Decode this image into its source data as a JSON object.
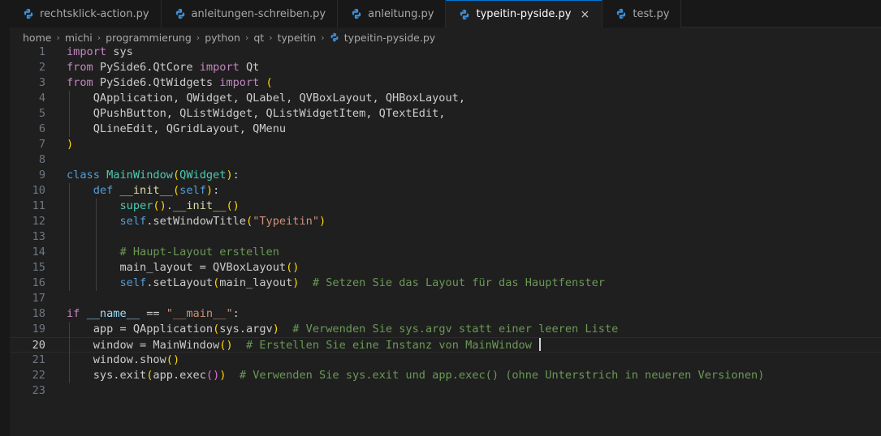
{
  "tabs": [
    {
      "label": "rechtsklick-action.py",
      "active": false
    },
    {
      "label": "anleitungen-schreiben.py",
      "active": false
    },
    {
      "label": "anleitung.py",
      "active": false
    },
    {
      "label": "typeitin-pyside.py",
      "active": true
    },
    {
      "label": "test.py",
      "active": false
    }
  ],
  "tab_close_glyph": "×",
  "breadcrumb": {
    "folders": [
      "home",
      "michi",
      "programmierung",
      "python",
      "qt",
      "typeitin"
    ],
    "file": "typeitin-pyside.py",
    "separator": "›"
  },
  "editor": {
    "current_line": 20,
    "lines": [
      {
        "n": "1",
        "tokens": [
          [
            "import",
            "kw2"
          ],
          [
            " sys",
            "tx"
          ]
        ]
      },
      {
        "n": "2",
        "tokens": [
          [
            "from",
            "kw2"
          ],
          [
            " PySide6.QtCore ",
            "tx"
          ],
          [
            "import",
            "kw2"
          ],
          [
            " Qt",
            "tx"
          ]
        ]
      },
      {
        "n": "3",
        "tokens": [
          [
            "from",
            "kw2"
          ],
          [
            " PySide6.QtWidgets ",
            "tx"
          ],
          [
            "import",
            "kw2"
          ],
          [
            " ",
            "tx"
          ],
          [
            "(",
            "br1"
          ]
        ]
      },
      {
        "n": "4",
        "tokens": [
          [
            "    QApplication, QWidget, QLabel, QVBoxLayout, QHBoxLayout,",
            "tx"
          ]
        ]
      },
      {
        "n": "5",
        "tokens": [
          [
            "    QPushButton, QListWidget, QListWidgetItem, QTextEdit,",
            "tx"
          ]
        ]
      },
      {
        "n": "6",
        "tokens": [
          [
            "    QLineEdit, QGridLayout, QMenu",
            "tx"
          ]
        ]
      },
      {
        "n": "7",
        "tokens": [
          [
            ")",
            "br1"
          ]
        ]
      },
      {
        "n": "8",
        "tokens": []
      },
      {
        "n": "9",
        "tokens": [
          [
            "class",
            "kw"
          ],
          [
            " ",
            "tx"
          ],
          [
            "MainWindow",
            "cls"
          ],
          [
            "(",
            "br1"
          ],
          [
            "QWidget",
            "cls"
          ],
          [
            ")",
            "br1"
          ],
          [
            ":",
            "tx"
          ]
        ]
      },
      {
        "n": "10",
        "tokens": [
          [
            "    ",
            "tx"
          ],
          [
            "def",
            "kw"
          ],
          [
            " ",
            "tx"
          ],
          [
            "__init__",
            "fn"
          ],
          [
            "(",
            "br1"
          ],
          [
            "self",
            "kw"
          ],
          [
            ")",
            "br1"
          ],
          [
            ":",
            "tx"
          ]
        ]
      },
      {
        "n": "11",
        "tokens": [
          [
            "        ",
            "tx"
          ],
          [
            "super",
            "cls"
          ],
          [
            "(",
            "br1"
          ],
          [
            ")",
            "br1"
          ],
          [
            ".",
            "tx"
          ],
          [
            "__init__",
            "fn"
          ],
          [
            "(",
            "br1"
          ],
          [
            ")",
            "br1"
          ]
        ]
      },
      {
        "n": "12",
        "tokens": [
          [
            "        ",
            "tx"
          ],
          [
            "self",
            "kw"
          ],
          [
            ".setWindowTitle",
            "tx"
          ],
          [
            "(",
            "br1"
          ],
          [
            "\"Typeitin\"",
            "str"
          ],
          [
            ")",
            "br1"
          ]
        ]
      },
      {
        "n": "13",
        "tokens": []
      },
      {
        "n": "14",
        "tokens": [
          [
            "        ",
            "tx"
          ],
          [
            "# Haupt-Layout erstellen",
            "cm"
          ]
        ]
      },
      {
        "n": "15",
        "tokens": [
          [
            "        main_layout = QVBoxLayout",
            "tx"
          ],
          [
            "(",
            "br1"
          ],
          [
            ")",
            "br1"
          ]
        ]
      },
      {
        "n": "16",
        "tokens": [
          [
            "        ",
            "tx"
          ],
          [
            "self",
            "kw"
          ],
          [
            ".setLayout",
            "tx"
          ],
          [
            "(",
            "br1"
          ],
          [
            "main_layout",
            "tx"
          ],
          [
            ")",
            "br1"
          ],
          [
            "  ",
            "tx"
          ],
          [
            "# Setzen Sie das Layout für das Hauptfenster",
            "cm"
          ]
        ]
      },
      {
        "n": "17",
        "tokens": []
      },
      {
        "n": "18",
        "tokens": [
          [
            "if",
            "kw2"
          ],
          [
            " ",
            "tx"
          ],
          [
            "__name__",
            "vr"
          ],
          [
            " == ",
            "tx"
          ],
          [
            "\"__main__\"",
            "str"
          ],
          [
            ":",
            "tx"
          ]
        ]
      },
      {
        "n": "19",
        "tokens": [
          [
            "    app = QApplication",
            "tx"
          ],
          [
            "(",
            "br1"
          ],
          [
            "sys.argv",
            "tx"
          ],
          [
            ")",
            "br1"
          ],
          [
            "  ",
            "tx"
          ],
          [
            "# Verwenden Sie sys.argv statt einer leeren Liste",
            "cm"
          ]
        ]
      },
      {
        "n": "20",
        "tokens": [
          [
            "    window = MainWindow",
            "tx"
          ],
          [
            "(",
            "br1"
          ],
          [
            ")",
            "br1"
          ],
          [
            "  ",
            "tx"
          ],
          [
            "# Erstellen Sie eine Instanz von MainWindow ",
            "cm"
          ]
        ],
        "cursor": true
      },
      {
        "n": "21",
        "tokens": [
          [
            "    window.show",
            "tx"
          ],
          [
            "(",
            "br1"
          ],
          [
            ")",
            "br1"
          ]
        ]
      },
      {
        "n": "22",
        "tokens": [
          [
            "    sys.exit",
            "tx"
          ],
          [
            "(",
            "br1"
          ],
          [
            "app.exec",
            "tx"
          ],
          [
            "(",
            "br2"
          ],
          [
            ")",
            "br2"
          ],
          [
            ")",
            "br1"
          ],
          [
            "  ",
            "tx"
          ],
          [
            "# Verwenden Sie sys.exit und app.exec() (ohne Unterstrich in neueren Versionen)",
            "cm"
          ]
        ]
      },
      {
        "n": "23",
        "tokens": []
      }
    ]
  },
  "colors": {
    "background": "#1f1f1f",
    "tabbar": "#181818",
    "active_tab_accent": "#0078d4",
    "python_icon_blue": "#3b8fd6",
    "python_icon_yellow": "#f5d04a"
  },
  "icons": {
    "file": "python-file-icon",
    "close": "close-icon",
    "separator": "chevron-right-icon"
  }
}
